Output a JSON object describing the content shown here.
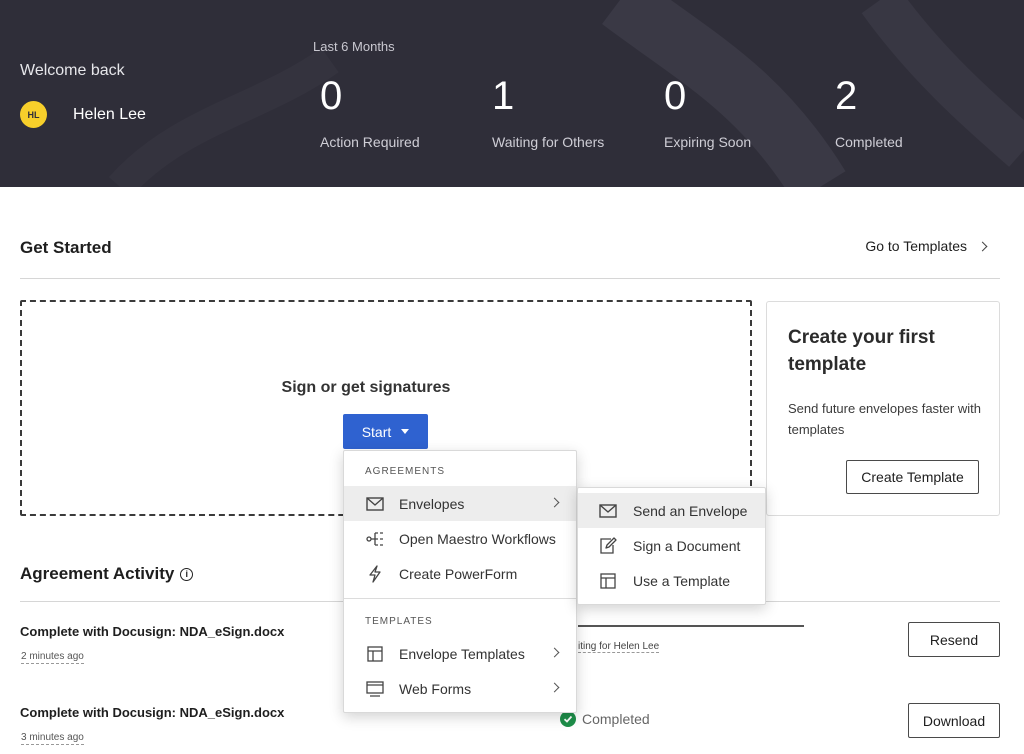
{
  "header": {
    "welcome": "Welcome back",
    "user": {
      "initials": "HL",
      "name": "Helen Lee"
    },
    "period": "Last 6 Months",
    "stats": [
      {
        "value": "0",
        "label": "Action Required"
      },
      {
        "value": "1",
        "label": "Waiting for Others"
      },
      {
        "value": "0",
        "label": "Expiring Soon"
      },
      {
        "value": "2",
        "label": "Completed"
      }
    ]
  },
  "get_started": {
    "title": "Get Started",
    "go_to_templates": "Go to Templates",
    "dropzone_title": "Sign or get signatures",
    "start_label": "Start",
    "template_card": {
      "title": "Create your first template",
      "description": "Send future envelopes faster with templates",
      "button": "Create Template"
    }
  },
  "start_menu": {
    "agreements_heading": "AGREEMENTS",
    "agreements": [
      {
        "label": "Envelopes",
        "icon": "envelope-icon",
        "submenu": true
      },
      {
        "label": "Open Maestro Workflows",
        "icon": "workflow-icon",
        "submenu": false
      },
      {
        "label": "Create PowerForm",
        "icon": "lightning-icon",
        "submenu": false
      }
    ],
    "templates_heading": "TEMPLATES",
    "templates": [
      {
        "label": "Envelope Templates",
        "icon": "template-icon",
        "submenu": true
      },
      {
        "label": "Web Forms",
        "icon": "web-form-icon",
        "submenu": true
      }
    ],
    "envelopes_submenu": [
      {
        "label": "Send an Envelope",
        "icon": "envelope-icon"
      },
      {
        "label": "Sign a Document",
        "icon": "sign-document-icon"
      },
      {
        "label": "Use a Template",
        "icon": "template-icon"
      }
    ]
  },
  "activity": {
    "title": "Agreement Activity",
    "rows": [
      {
        "title": "Complete with Docusign: NDA_eSign.docx",
        "time": "2 minutes ago",
        "status": "iting for Helen Lee",
        "action": "Resend"
      },
      {
        "title": "Complete with Docusign: NDA_eSign.docx",
        "time": "3 minutes ago",
        "status": "Completed",
        "action": "Download"
      }
    ]
  },
  "colors": {
    "header_bg": "#2f2e39",
    "primary": "#2f62d0",
    "avatar": "#f7cf2b",
    "success": "#1e8f4a"
  }
}
